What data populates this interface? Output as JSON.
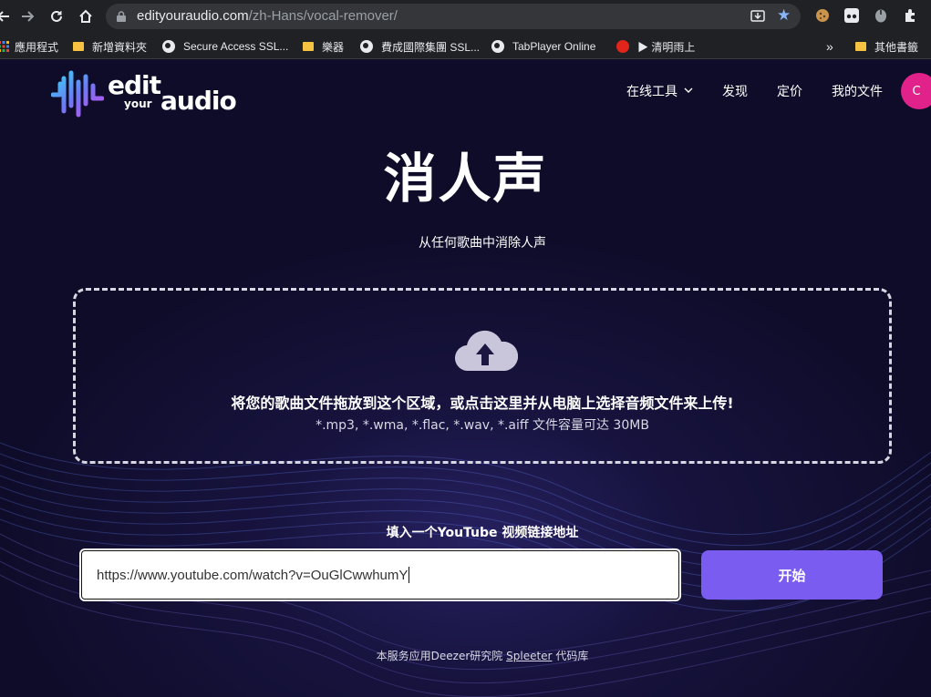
{
  "browser": {
    "url_host": "edityouraudio.com",
    "url_path": "/zh-Hans/vocal-remover/",
    "nav_icons": [
      "back-icon",
      "forward-icon",
      "reload-icon",
      "home-icon"
    ],
    "bookmarks": [
      {
        "label": "應用程式",
        "icon": "apps-grid-icon"
      },
      {
        "label": "新增資料夾",
        "icon": "folder-icon"
      },
      {
        "label": "Secure Access SSL...",
        "icon": "globe-icon"
      },
      {
        "label": "樂器",
        "icon": "folder-icon"
      },
      {
        "label": "費成國際集團 SSL...",
        "icon": "globe-icon"
      },
      {
        "label": "TabPlayer Online",
        "icon": "globe-icon"
      },
      {
        "label": "▶ 清明雨上",
        "icon": "netease-music-icon"
      },
      {
        "label": "其他書籤",
        "icon": "folder-icon"
      }
    ],
    "overflow": "»"
  },
  "site": {
    "logo_edit": "edit",
    "logo_your": "your",
    "logo_audio": "audio",
    "nav": {
      "tools": "在线工具",
      "discover": "发现",
      "pricing": "定价",
      "my_files": "我的文件",
      "avatar_initial": "C"
    }
  },
  "hero": {
    "title": "消人声",
    "subtitle": "从任何歌曲中消除人声"
  },
  "dropzone": {
    "instruction": "将您的歌曲文件拖放到这个区域，或点击这里并从电脑上选择音频文件来上传!",
    "formats": "*.mp3, *.wma, *.flac, *.wav, *.aiff 文件容量可达 30MB"
  },
  "youtube": {
    "label": "填入一个YouTube 视频链接地址",
    "value": "https://www.youtube.com/watch?v=OuGlCwwhumY",
    "button": "开始"
  },
  "footer": {
    "prefix": "本服务应用Deezer研究院",
    "link": "Spleeter",
    "suffix": "代码库"
  },
  "colors": {
    "page_bg": "#0f0c2a",
    "accent_purple": "#7a5cf0",
    "avatar_pink": "#e0228a",
    "star_blue": "#8ab4f8"
  }
}
